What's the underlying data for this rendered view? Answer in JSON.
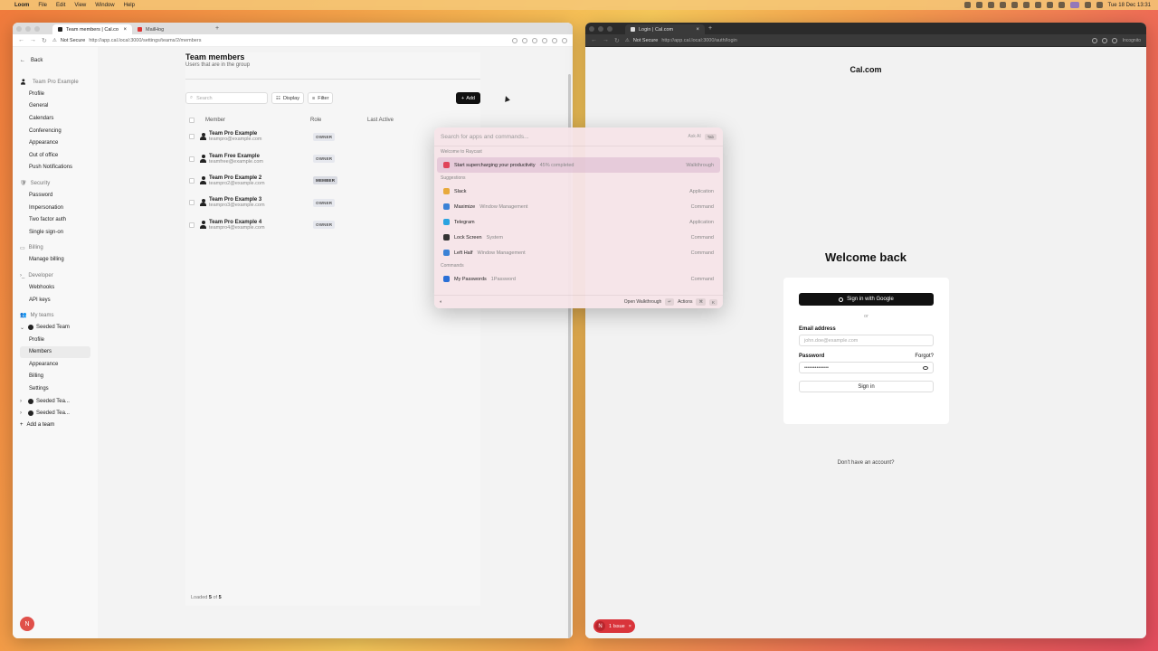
{
  "menubar": {
    "app": "Loom",
    "items": [
      "File",
      "Edit",
      "View",
      "Window",
      "Help"
    ],
    "clock": "Tue 18 Dec  13:31"
  },
  "left_window": {
    "tabs": [
      {
        "label": "Team members | Cal.co"
      },
      {
        "label": "MailHog"
      }
    ],
    "not_secure": "Not Secure",
    "url": "http://app.cal.local:3000/settings/teams/2/members",
    "sidebar": {
      "back": "Back",
      "team_header": "Team Pro Example",
      "team_items": [
        "Profile",
        "General",
        "Calendars",
        "Conferencing",
        "Appearance",
        "Out of office",
        "Push Notifications"
      ],
      "security_header": "Security",
      "security_items": [
        "Password",
        "Impersonation",
        "Two factor auth",
        "Single sign-on"
      ],
      "billing_header": "Billing",
      "billing_items": [
        "Manage billing"
      ],
      "developer_header": "Developer",
      "developer_items": [
        "Webhooks",
        "API keys"
      ],
      "myteams_header": "My teams",
      "seeded_team": "Seeded Team",
      "seeded_items": [
        "Profile",
        "Members",
        "Appearance",
        "Billing",
        "Settings"
      ],
      "other_teams": [
        "Seeded Tea...",
        "Seeded Tea..."
      ],
      "add_team": "Add a team",
      "n_badge": "N"
    },
    "page": {
      "title": "Team members",
      "subtitle": "Users that are in the group",
      "search_placeholder": "Search",
      "display_btn": "Display",
      "filter_btn": "Filter",
      "add_btn": "Add",
      "columns": [
        "Member",
        "Role",
        "Last Active"
      ],
      "members": [
        {
          "name": "Team Pro Example",
          "email": "teampro@example.com",
          "role": "OWNER"
        },
        {
          "name": "Team Free Example",
          "email": "teamfree@example.com",
          "role": "OWNER"
        },
        {
          "name": "Team Pro Example 2",
          "email": "teampro2@example.com",
          "role": "MEMBER"
        },
        {
          "name": "Team Pro Example 3",
          "email": "teampro3@example.com",
          "role": "OWNER"
        },
        {
          "name": "Team Pro Example 4",
          "email": "teampro4@example.com",
          "role": "OWNER"
        }
      ],
      "loaded_prefix": "Loaded",
      "loaded_count": "5",
      "loaded_of": "of",
      "loaded_total": "5"
    }
  },
  "raycast": {
    "placeholder": "Search for apps and commands...",
    "ask_ai": "Ask AI",
    "tab_key": "Tab",
    "welcome_section": "Welcome to Raycast",
    "welcome_item": {
      "title": "Start supercharging your productivity",
      "sub": "45% completed",
      "acc": "Walkthrough",
      "color": "#e0445a"
    },
    "suggestions_section": "Suggestions",
    "suggestions": [
      {
        "title": "Slack",
        "sub": "",
        "acc": "Application",
        "color": "#e8a93b"
      },
      {
        "title": "Maximize",
        "sub": "Window Management",
        "acc": "Command",
        "color": "#3b82d6"
      },
      {
        "title": "Telegram",
        "sub": "",
        "acc": "Application",
        "color": "#2aa3e0"
      },
      {
        "title": "Lock Screen",
        "sub": "System",
        "acc": "Command",
        "color": "#333333"
      },
      {
        "title": "Left Half",
        "sub": "Window Management",
        "acc": "Command",
        "color": "#3b82d6"
      }
    ],
    "commands_section": "Commands",
    "commands": [
      {
        "title": "My Passwords",
        "sub": "1Password",
        "acc": "Command",
        "color": "#2a6fd6"
      }
    ],
    "footer_action": "Open Walkthrough",
    "footer_enter": "↵",
    "footer_actions": "Actions",
    "footer_cmd": "⌘",
    "footer_k": "K"
  },
  "right_window": {
    "tab": "Login | Cal.com",
    "not_secure": "Not Secure",
    "url": "http://app.cal.local:3000/auth/login",
    "incognito": "Incognito",
    "brand": "Cal.com",
    "welcome": "Welcome back",
    "google_btn": "Sign in with Google",
    "or": "or",
    "email_label": "Email address",
    "email_placeholder": "john.doe@example.com",
    "password_label": "Password",
    "forgot": "Forgot?",
    "password_value": "••••••••••••••",
    "signin_btn": "Sign in",
    "no_account": "Don't have an account?",
    "issue_n": "N",
    "issue_label": "1 Issue",
    "issue_close": "×"
  }
}
